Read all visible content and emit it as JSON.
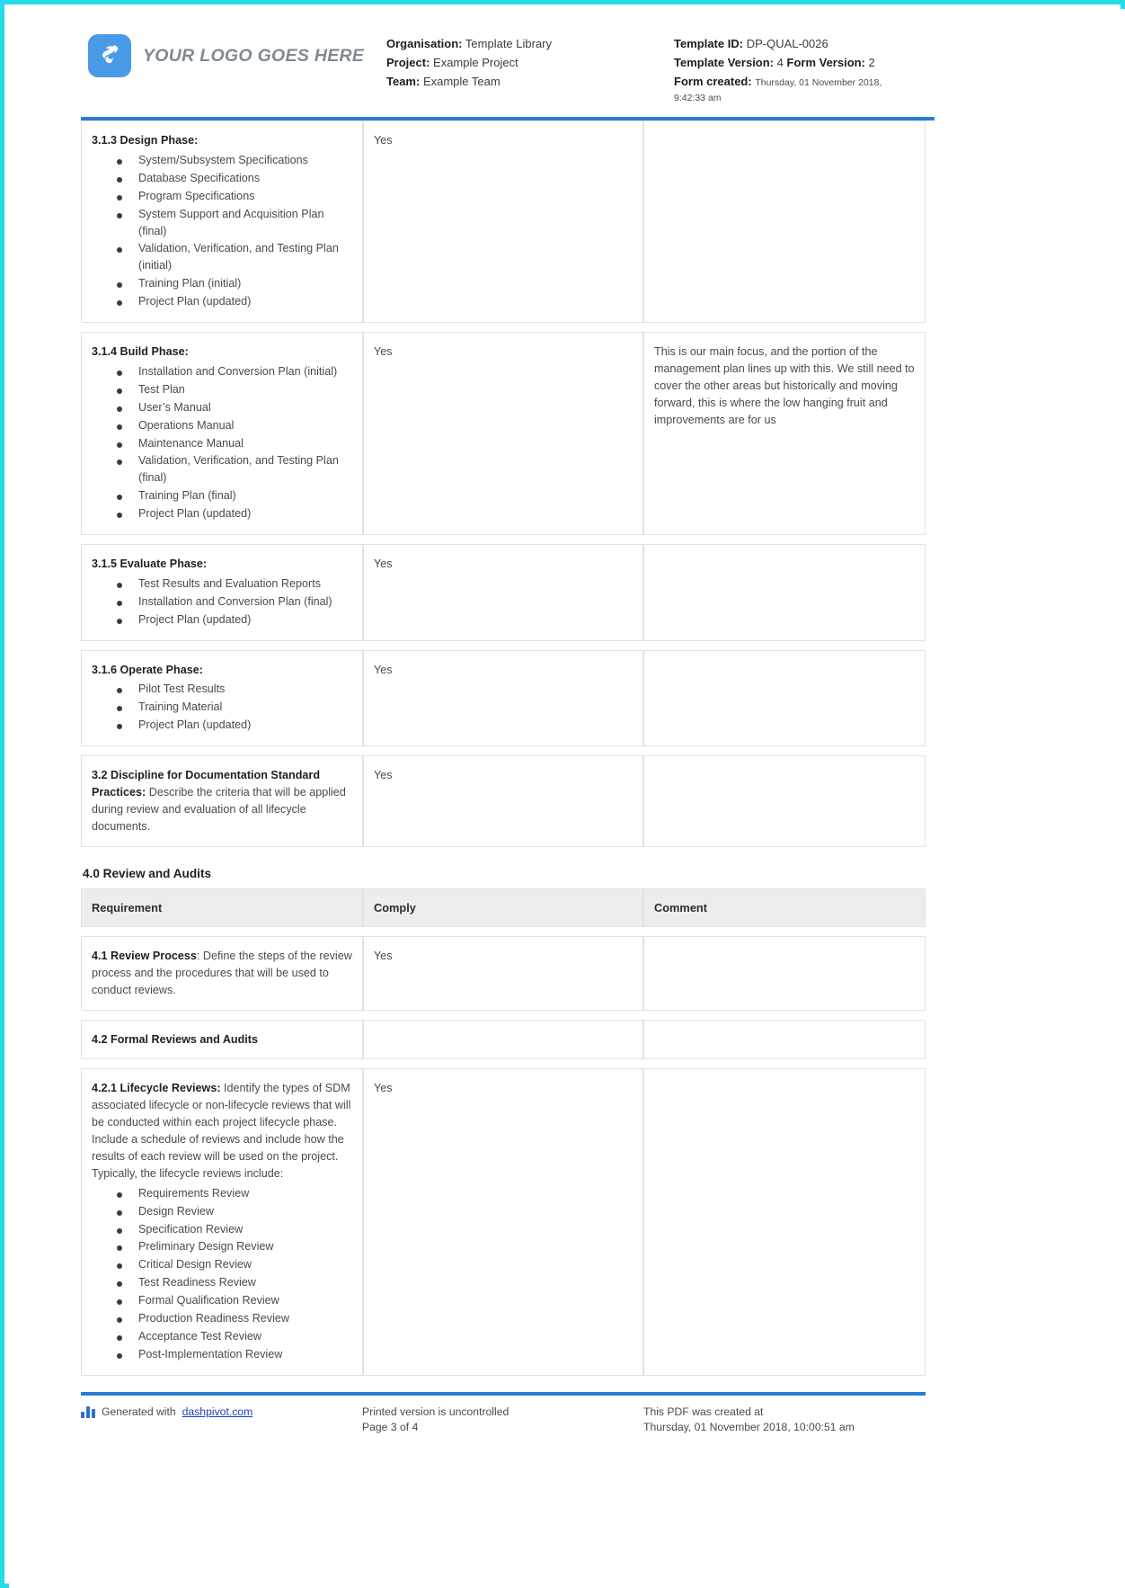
{
  "header": {
    "logo_text": "YOUR LOGO GOES HERE",
    "left": {
      "organisation_label": "Organisation:",
      "organisation_value": "Template Library",
      "project_label": "Project:",
      "project_value": "Example Project",
      "team_label": "Team:",
      "team_value": "Example Team"
    },
    "right": {
      "template_id_label": "Template ID:",
      "template_id_value": "DP-QUAL-0026",
      "template_version_label": "Template Version:",
      "template_version_value": "4",
      "form_version_label": "Form Version:",
      "form_version_value": "2",
      "form_created_label": "Form created:",
      "form_created_value": "Thursday, 01 November 2018,",
      "form_created_time": "9:42:33 am"
    }
  },
  "section3": {
    "rows": [
      {
        "title": "3.1.3 Design Phase:",
        "bullets": [
          "System/Subsystem Specifications",
          "Database Specifications",
          "Program Specifications",
          "System Support and Acquisition Plan (final)",
          "Validation, Verification, and Testing Plan (initial)",
          "Training Plan (initial)",
          "Project Plan (updated)"
        ],
        "comply": "Yes",
        "comment": ""
      },
      {
        "title": "3.1.4 Build Phase:",
        "bullets": [
          "Installation and Conversion Plan (initial)",
          "Test Plan",
          "User’s Manual",
          "Operations Manual",
          "Maintenance Manual",
          "Validation, Verification, and Testing Plan (final)",
          "Training Plan (final)",
          "Project Plan (updated)"
        ],
        "comply": "Yes",
        "comment": "This is our main focus, and the portion of the management plan lines up with this. We still need to cover the other areas but historically and moving forward, this is where the low hanging fruit and improvements are for us"
      },
      {
        "title": "3.1.5 Evaluate Phase:",
        "bullets": [
          "Test Results and Evaluation Reports",
          "Installation and Conversion Plan (final)",
          "Project Plan (updated)"
        ],
        "comply": "Yes",
        "comment": ""
      },
      {
        "title": "3.1.6 Operate Phase:",
        "bullets": [
          "Pilot Test Results",
          "Training Material",
          "Project Plan (updated)"
        ],
        "comply": "Yes",
        "comment": ""
      }
    ],
    "discipline_row": {
      "title": "3.2 Discipline for Documentation Standard Practices:",
      "body": " Describe the criteria that will be applied during review and evaluation of all lifecycle documents.",
      "comply": "Yes",
      "comment": ""
    }
  },
  "section4": {
    "heading": "4.0 Review and Audits",
    "columns": [
      "Requirement",
      "Comply",
      "Comment"
    ],
    "rows": [
      {
        "title": "4.1 Review Process",
        "body": ": Define the steps of the review process and the procedures that will be used to conduct reviews.",
        "comply": "Yes",
        "comment": ""
      },
      {
        "title": "4.2 Formal Reviews and Audits",
        "body": "",
        "comply": "",
        "comment": ""
      },
      {
        "title": "4.2.1 Lifecycle Reviews:",
        "body": " Identify the types of SDM associated lifecycle or non-lifecycle reviews that will be conducted within each project lifecycle phase. Include a schedule of reviews and include how the results of each review will be used on the project.",
        "body2": "Typically, the lifecycle reviews include:",
        "bullets": [
          "Requirements Review",
          "Design Review",
          "Specification Review",
          "Preliminary Design Review",
          "Critical Design Review",
          "Test Readiness Review",
          "Formal Qualification Review",
          "Production Readiness Review",
          "Acceptance Test Review",
          "Post-Implementation Review"
        ],
        "comply": "Yes",
        "comment": ""
      }
    ]
  },
  "footer": {
    "generated_prefix": "Generated with ",
    "generated_link": "dashpivot.com",
    "printed_line1": "Printed version is uncontrolled",
    "printed_line2": "Page 3 of 4",
    "created_line1": "This PDF was created at",
    "created_line2": "Thursday, 01 November 2018, 10:00:51 am"
  },
  "colors": {
    "accent_rule": "#2a7ed1",
    "page_border": "#25dce8",
    "logo_bg": "#4a9ae8",
    "table_header_bg": "#ededed"
  }
}
